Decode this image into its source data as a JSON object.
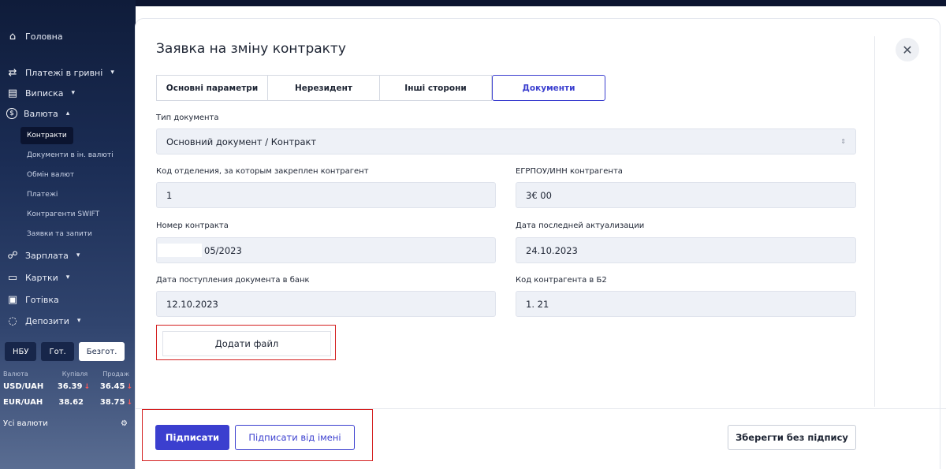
{
  "sidebar": {
    "items": [
      {
        "label": "Головна",
        "icon": "home-icon",
        "glyph": "⌂"
      },
      {
        "label": "Платежі в гривні",
        "icon": "transfer-icon",
        "glyph": "⇄"
      },
      {
        "label": "Виписка",
        "icon": "statement-icon",
        "glyph": "▤"
      },
      {
        "label": "Валюта",
        "icon": "currency-icon",
        "glyph": "$"
      },
      {
        "label": "Зарплата",
        "icon": "people-icon",
        "glyph": "☍"
      },
      {
        "label": "Картки",
        "icon": "card-icon",
        "glyph": "▭"
      },
      {
        "label": "Готівка",
        "icon": "cash-icon",
        "glyph": "▣"
      },
      {
        "label": "Депозити",
        "icon": "deposit-icon",
        "glyph": "◌"
      }
    ],
    "currency_sub": [
      "Контракти",
      "Документи в ін. валюті",
      "Обмін валют",
      "Платежі",
      "Контрагенти SWIFT",
      "Заявки та запити"
    ],
    "rates": {
      "tabs": [
        "НБУ",
        "Гот.",
        "Безгот."
      ],
      "headers": [
        "Валюта",
        "Купівля",
        "Продаж"
      ],
      "rows": [
        {
          "pair": "USD/UAH",
          "buy": "36.39",
          "sell": "36.45"
        },
        {
          "pair": "EUR/UAH",
          "buy": "38.62",
          "sell": "38.75"
        }
      ],
      "all_label": "Усі валюти"
    }
  },
  "modal": {
    "title": "Заявка на зміну контракту",
    "tabs": [
      "Основні параметри",
      "Нерезидент",
      "Інші сторони",
      "Документи"
    ],
    "active_tab": "Документи",
    "fields": {
      "doc_type_label": "Тип документа",
      "doc_type_value": "Основний документ / Контракт",
      "branch_label": "Код отделения, за которым закреплен контрагент",
      "branch_value": "1",
      "edrpou_label": "ЕГРПОУ/ИНН контрагента",
      "edrpou_value": "3€ 00",
      "contract_label": "Номер контракта",
      "contract_value": "05/2023",
      "update_label": "Дата последней актуализации",
      "update_value": "24.10.2023",
      "received_label": "Дата поступления документа в банк",
      "received_value": "12.10.2023",
      "b2_label": "Код контрагента в Б2",
      "b2_value": "1. 21"
    },
    "add_file": "Додати файл",
    "buttons": {
      "sign": "Підписати",
      "sign_as": "Підписати від імені",
      "save": "Зберегти без підпису"
    }
  },
  "colors": {
    "accent": "#3b3fcf",
    "highlight": "#d41f1f"
  }
}
